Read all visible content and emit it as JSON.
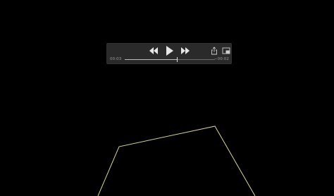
{
  "player": {
    "elapsed": "00:03",
    "remaining": "−00:02",
    "progress_fraction": 0.58,
    "buttons": {
      "rewind_icon": "rewind-icon",
      "play_icon": "play-icon",
      "fast_forward_icon": "fast-forward-icon",
      "share_icon": "share-icon",
      "pip_icon": "picture-in-picture-icon"
    }
  },
  "colors": {
    "background": "#000000",
    "control_bar": "#2a2a2a",
    "icon": "#e6e6e6",
    "shape_line": "#d8d39a"
  }
}
